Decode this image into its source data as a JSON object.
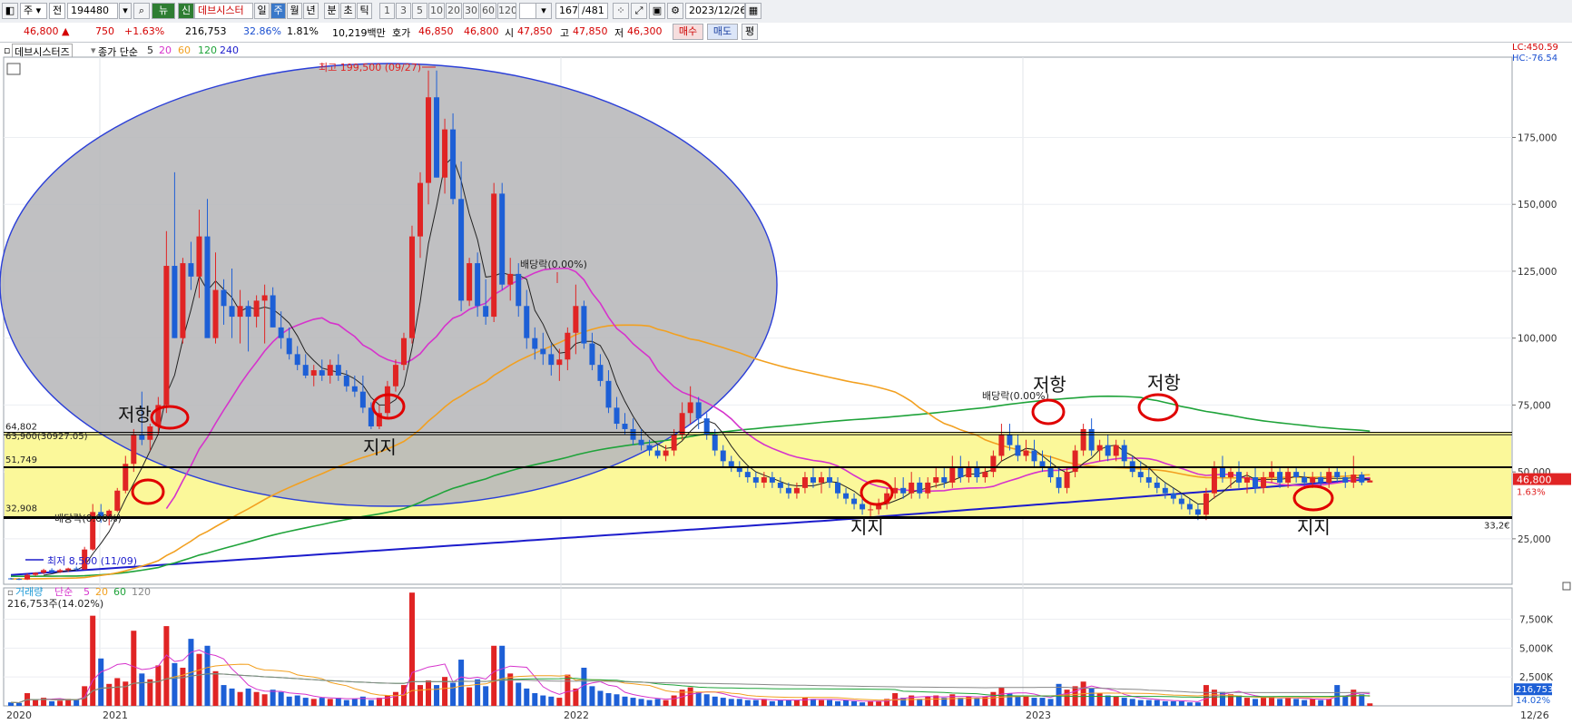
{
  "toolbar": {
    "mode": "주",
    "range": "전",
    "code": "194480",
    "new_badge": "뉴",
    "new_label": "신",
    "stock_name": "데브시스터",
    "periods": [
      "일",
      "주",
      "월",
      "년",
      "분",
      "초",
      "틱"
    ],
    "selected_period": "주",
    "intervals": [
      "1",
      "3",
      "5",
      "10",
      "20",
      "30",
      "60",
      "120"
    ],
    "count": "167",
    "total": "/481",
    "date": "2023/12/26"
  },
  "quote": {
    "price": "46,800 ▲",
    "change": "750",
    "change_pct": "+1.63%",
    "volume": "216,753",
    "turnover_pct": "32.86%",
    "ratio": "1.81%",
    "amount": "10,219백만",
    "hoga_label": "호가",
    "hoga_ask": "46,850",
    "hoga_bid": "46,800",
    "open_label": "시",
    "open": "47,850",
    "high_label": "고",
    "high": "47,850",
    "low_label": "저",
    "low": "46,300",
    "buy_btn": "매수",
    "sell_btn": "매도",
    "eval_btn": "평"
  },
  "legend": {
    "name": "데브시스터즈",
    "type": "종가 단순",
    "ma": [
      "5",
      "20",
      "60",
      "120",
      "240"
    ],
    "colors": {
      "ma5": "#222222",
      "ma20": "#d633cc",
      "ma60": "#f2a020",
      "ma120": "#1fa33a",
      "ma240": "#1c1ccc"
    },
    "lc": "LC:450.59",
    "hc": "HC:-76.54"
  },
  "volume_legend": {
    "name": "거래량",
    "type": "단순",
    "ma": [
      "5",
      "20",
      "60",
      "120"
    ],
    "current": "216,753주(14.02%)"
  },
  "chart_data": {
    "type": "candlestick",
    "x_labels": [
      "2020",
      "2021",
      "2022",
      "2023",
      "12/26"
    ],
    "y_ticks": [
      "175,000",
      "150,000",
      "125,000",
      "100,000",
      "75,000",
      "50,000",
      "25,000"
    ],
    "ylim": [
      8000,
      205000
    ],
    "volume_ticks": [
      "7,500K",
      "5,000K",
      "2,500K"
    ],
    "volume_ylim": [
      0,
      9500
    ],
    "price_tag": {
      "value": "46,800",
      "pct": "1.63%"
    },
    "volume_tag": {
      "value": "216,753",
      "pct": "14.02%"
    },
    "right_low_label": "33,2€",
    "hlines": [
      {
        "value": 64802,
        "label": "64,802"
      },
      {
        "value": 63900,
        "label": "63,900(30927.05)"
      },
      {
        "value": 51749,
        "label": "51,749"
      },
      {
        "value": 32908,
        "label": "32,908"
      }
    ],
    "annotations": {
      "high": "최고 199,500 (09/27)",
      "low": "최저 8,500 (11/09)",
      "dividend1": "배당락(0.00%)",
      "dividend2": "배당락(0.00%)",
      "dividend3": "배당락(0.00%)",
      "resistance": "저항",
      "support": "지지"
    },
    "candles": [
      [
        10200,
        10400,
        9800,
        10000,
        300
      ],
      [
        10000,
        10300,
        9600,
        9800,
        250
      ],
      [
        9800,
        12000,
        9600,
        11500,
        1100
      ],
      [
        11500,
        12500,
        11000,
        12300,
        500
      ],
      [
        12300,
        13800,
        11800,
        13300,
        700
      ],
      [
        13300,
        14000,
        12000,
        12600,
        400
      ],
      [
        12600,
        13800,
        12200,
        13300,
        450
      ],
      [
        13300,
        14200,
        12600,
        13900,
        600
      ],
      [
        13900,
        14600,
        13000,
        13600,
        500
      ],
      [
        13600,
        22000,
        13400,
        21000,
        1700
      ],
      [
        21000,
        38000,
        20500,
        35000,
        7800
      ],
      [
        35000,
        38000,
        31000,
        33000,
        4100
      ],
      [
        33000,
        36000,
        30000,
        35500,
        1900
      ],
      [
        35500,
        44000,
        35000,
        43000,
        2400
      ],
      [
        43000,
        56000,
        42000,
        53000,
        2100
      ],
      [
        53000,
        66000,
        50000,
        64000,
        6500
      ],
      [
        64000,
        80000,
        60000,
        62000,
        2800
      ],
      [
        62000,
        68000,
        58000,
        67000,
        2300
      ],
      [
        67000,
        78000,
        64000,
        75000,
        3500
      ],
      [
        75000,
        140000,
        72000,
        127000,
        6900
      ],
      [
        127000,
        162000,
        100000,
        100000,
        3700
      ],
      [
        100000,
        130000,
        98000,
        128000,
        3300
      ],
      [
        128000,
        136000,
        118000,
        123000,
        5800
      ],
      [
        123000,
        148000,
        115000,
        138000,
        4500
      ],
      [
        138000,
        152000,
        105000,
        100000,
        5200
      ],
      [
        100000,
        132000,
        98000,
        118000,
        3000
      ],
      [
        118000,
        122000,
        105000,
        112000,
        1800
      ],
      [
        112000,
        126000,
        100000,
        108000,
        1500
      ],
      [
        108000,
        118000,
        98000,
        112000,
        1200
      ],
      [
        112000,
        114000,
        95000,
        108000,
        1500
      ],
      [
        108000,
        116000,
        104000,
        114000,
        1200
      ],
      [
        114000,
        120000,
        98000,
        116000,
        1000
      ],
      [
        116000,
        119000,
        104000,
        104000,
        1400
      ],
      [
        104000,
        110000,
        96000,
        100000,
        1200
      ],
      [
        100000,
        104000,
        92000,
        94000,
        800
      ],
      [
        94000,
        97000,
        88000,
        90000,
        900
      ],
      [
        90000,
        94000,
        85000,
        86000,
        700
      ],
      [
        86000,
        90000,
        82000,
        88000,
        600
      ],
      [
        88000,
        92000,
        84000,
        86000,
        700
      ],
      [
        86000,
        92000,
        83000,
        90000,
        600
      ],
      [
        90000,
        94000,
        84000,
        86000,
        700
      ],
      [
        86000,
        88000,
        80000,
        82000,
        500
      ],
      [
        82000,
        86000,
        78000,
        80000,
        600
      ],
      [
        80000,
        86000,
        72000,
        74000,
        800
      ],
      [
        74000,
        76000,
        66000,
        67000,
        500
      ],
      [
        67000,
        75000,
        66000,
        72000,
        700
      ],
      [
        72000,
        84000,
        70000,
        82000,
        900
      ],
      [
        82000,
        92000,
        80000,
        90000,
        1200
      ],
      [
        90000,
        102000,
        88000,
        100000,
        1800
      ],
      [
        100000,
        142000,
        98000,
        138000,
        9800
      ],
      [
        138000,
        162000,
        130000,
        158000,
        1800
      ],
      [
        158000,
        200000,
        150000,
        190000,
        2200
      ],
      [
        190000,
        200000,
        160000,
        160000,
        1800
      ],
      [
        160000,
        182000,
        154000,
        178000,
        2500
      ],
      [
        178000,
        184000,
        150000,
        152000,
        2000
      ],
      [
        152000,
        166000,
        110000,
        114000,
        4000
      ],
      [
        114000,
        130000,
        112000,
        128000,
        1600
      ],
      [
        128000,
        132000,
        108000,
        112000,
        2300
      ],
      [
        112000,
        122000,
        105000,
        108000,
        1700
      ],
      [
        108000,
        158000,
        106000,
        154000,
        5200
      ],
      [
        154000,
        158000,
        118000,
        120000,
        5200
      ],
      [
        120000,
        130000,
        114000,
        124000,
        2800
      ],
      [
        124000,
        128000,
        108000,
        112000,
        2000
      ],
      [
        112000,
        118000,
        96000,
        100000,
        1500
      ],
      [
        100000,
        104000,
        92000,
        96000,
        1100
      ],
      [
        96000,
        102000,
        90000,
        94000,
        900
      ],
      [
        94000,
        98000,
        86000,
        90000,
        800
      ],
      [
        90000,
        96000,
        84000,
        92000,
        700
      ],
      [
        92000,
        104000,
        88000,
        102000,
        2700
      ],
      [
        102000,
        120000,
        94000,
        112000,
        1500
      ],
      [
        112000,
        114000,
        96000,
        98000,
        3300
      ],
      [
        98000,
        102000,
        88000,
        90000,
        1700
      ],
      [
        90000,
        94000,
        82000,
        84000,
        1300
      ],
      [
        84000,
        88000,
        72000,
        74000,
        1100
      ],
      [
        74000,
        78000,
        66000,
        68000,
        1000
      ],
      [
        68000,
        72000,
        64000,
        66000,
        800
      ],
      [
        66000,
        70000,
        60000,
        62000,
        700
      ],
      [
        62000,
        66000,
        58000,
        60000,
        600
      ],
      [
        60000,
        62000,
        56000,
        58000,
        500
      ],
      [
        58000,
        60000,
        55000,
        56000,
        600
      ],
      [
        56000,
        60000,
        54000,
        58000,
        500
      ],
      [
        58000,
        66000,
        56000,
        64000,
        900
      ],
      [
        64000,
        76000,
        62000,
        72000,
        1400
      ],
      [
        72000,
        82000,
        68000,
        76000,
        1600
      ],
      [
        76000,
        78000,
        66000,
        70000,
        1200
      ],
      [
        70000,
        72000,
        62000,
        64000,
        1000
      ],
      [
        64000,
        66000,
        56000,
        58000,
        800
      ],
      [
        58000,
        60000,
        52000,
        54000,
        700
      ],
      [
        54000,
        56000,
        50000,
        52000,
        600
      ],
      [
        52000,
        54000,
        48000,
        50000,
        600
      ],
      [
        50000,
        52000,
        46000,
        48000,
        500
      ],
      [
        48000,
        50000,
        44000,
        46000,
        500
      ],
      [
        46000,
        50000,
        44000,
        48000,
        600
      ],
      [
        48000,
        50000,
        44000,
        46000,
        400
      ],
      [
        46000,
        48000,
        42000,
        44000,
        500
      ],
      [
        44000,
        46000,
        40000,
        42000,
        500
      ],
      [
        42000,
        46000,
        40000,
        44000,
        500
      ],
      [
        44000,
        50000,
        42000,
        48000,
        700
      ],
      [
        48000,
        52000,
        44000,
        46000,
        600
      ],
      [
        46000,
        50000,
        42000,
        48000,
        500
      ],
      [
        48000,
        52000,
        44000,
        46000,
        500
      ],
      [
        46000,
        48000,
        40000,
        42000,
        400
      ],
      [
        42000,
        44000,
        38000,
        40000,
        500
      ],
      [
        40000,
        42000,
        36000,
        38000,
        400
      ],
      [
        38000,
        40000,
        34000,
        36000,
        300
      ],
      [
        36000,
        38000,
        33000,
        36000,
        400
      ],
      [
        36000,
        40000,
        34000,
        38000,
        400
      ],
      [
        38000,
        44000,
        36000,
        42000,
        600
      ],
      [
        42000,
        48000,
        40000,
        44000,
        1100
      ],
      [
        44000,
        48000,
        40000,
        42000,
        700
      ],
      [
        42000,
        50000,
        40000,
        46000,
        900
      ],
      [
        46000,
        48000,
        40000,
        42000,
        600
      ],
      [
        42000,
        48000,
        40000,
        46000,
        800
      ],
      [
        46000,
        52000,
        44000,
        48000,
        900
      ],
      [
        48000,
        52000,
        44000,
        46000,
        700
      ],
      [
        46000,
        56000,
        44000,
        52000,
        1000
      ],
      [
        52000,
        56000,
        46000,
        48000,
        700
      ],
      [
        48000,
        54000,
        46000,
        52000,
        800
      ],
      [
        52000,
        54000,
        46000,
        48000,
        700
      ],
      [
        48000,
        52000,
        46000,
        50000,
        800
      ],
      [
        50000,
        58000,
        48000,
        56000,
        1200
      ],
      [
        56000,
        68000,
        54000,
        64000,
        1600
      ],
      [
        64000,
        68000,
        58000,
        60000,
        1100
      ],
      [
        60000,
        64000,
        54000,
        56000,
        900
      ],
      [
        56000,
        62000,
        54000,
        58000,
        800
      ],
      [
        58000,
        62000,
        52000,
        54000,
        700
      ],
      [
        54000,
        58000,
        50000,
        52000,
        700
      ],
      [
        52000,
        56000,
        46000,
        48000,
        600
      ],
      [
        48000,
        52000,
        42000,
        44000,
        1900
      ],
      [
        44000,
        52000,
        42000,
        50000,
        1400
      ],
      [
        50000,
        60000,
        48000,
        58000,
        1700
      ],
      [
        58000,
        68000,
        56000,
        66000,
        2100
      ],
      [
        66000,
        70000,
        56000,
        58000,
        1500
      ],
      [
        58000,
        62000,
        54000,
        60000,
        1100
      ],
      [
        60000,
        64000,
        54000,
        56000,
        900
      ],
      [
        56000,
        62000,
        54000,
        60000,
        800
      ],
      [
        60000,
        62000,
        52000,
        54000,
        700
      ],
      [
        54000,
        56000,
        48000,
        50000,
        600
      ],
      [
        50000,
        54000,
        46000,
        48000,
        500
      ],
      [
        48000,
        52000,
        44000,
        46000,
        500
      ],
      [
        46000,
        48000,
        42000,
        44000,
        500
      ],
      [
        44000,
        46000,
        40000,
        42000,
        400
      ],
      [
        42000,
        44000,
        38000,
        40000,
        400
      ],
      [
        40000,
        42000,
        36000,
        38000,
        400
      ],
      [
        38000,
        40000,
        34000,
        36000,
        300
      ],
      [
        36000,
        38000,
        32000,
        34000,
        300
      ],
      [
        34000,
        44000,
        32000,
        42000,
        1800
      ],
      [
        42000,
        54000,
        40000,
        52000,
        1400
      ],
      [
        52000,
        56000,
        46000,
        48000,
        1200
      ],
      [
        48000,
        52000,
        44000,
        50000,
        1000
      ],
      [
        50000,
        54000,
        44000,
        46000,
        900
      ],
      [
        46000,
        50000,
        42000,
        48000,
        700
      ],
      [
        48000,
        52000,
        42000,
        44000,
        600
      ],
      [
        44000,
        50000,
        42000,
        48000,
        700
      ],
      [
        48000,
        54000,
        46000,
        50000,
        800
      ],
      [
        50000,
        52000,
        44000,
        46000,
        600
      ],
      [
        46000,
        52000,
        44000,
        50000,
        700
      ],
      [
        50000,
        52000,
        46000,
        48000,
        600
      ],
      [
        48000,
        50000,
        44000,
        46000,
        500
      ],
      [
        46000,
        50000,
        44000,
        48000,
        600
      ],
      [
        48000,
        50000,
        44000,
        46000,
        500
      ],
      [
        46000,
        52000,
        44000,
        50000,
        600
      ],
      [
        50000,
        52000,
        46000,
        48000,
        1800
      ],
      [
        48000,
        50000,
        44000,
        46000,
        800
      ],
      [
        46000,
        56000,
        44000,
        49000,
        1400
      ],
      [
        49000,
        50000,
        45000,
        46050,
        1000
      ],
      [
        46050,
        47850,
        46300,
        46800,
        217
      ]
    ]
  }
}
